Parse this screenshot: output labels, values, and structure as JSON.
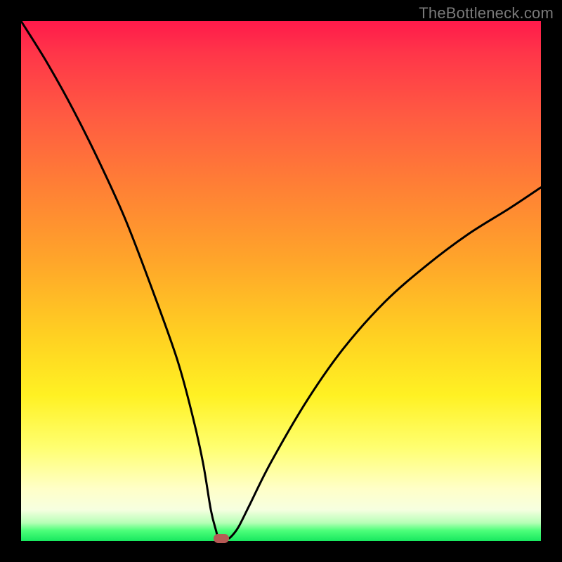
{
  "watermark": "TheBottleneck.com",
  "chart_data": {
    "type": "line",
    "title": "",
    "xlabel": "",
    "ylabel": "",
    "xlim": [
      0,
      100
    ],
    "ylim": [
      0,
      100
    ],
    "series": [
      {
        "name": "bottleneck-curve",
        "x": [
          0,
          5,
          10,
          15,
          20,
          25,
          30,
          33,
          35,
          36.5,
          37.5,
          38,
          39,
          40,
          41,
          42,
          44,
          48,
          55,
          62,
          70,
          78,
          86,
          94,
          100
        ],
        "y": [
          100,
          92,
          83,
          73,
          62,
          49,
          35,
          24,
          15,
          6,
          2,
          0.5,
          0.5,
          0.5,
          1.5,
          3,
          7,
          15,
          27,
          37,
          46,
          53,
          59,
          64,
          68
        ]
      }
    ],
    "annotations": [
      {
        "name": "min-marker",
        "x": 38.5,
        "y": 0.5,
        "color": "#b65a55"
      }
    ],
    "grid": false
  }
}
